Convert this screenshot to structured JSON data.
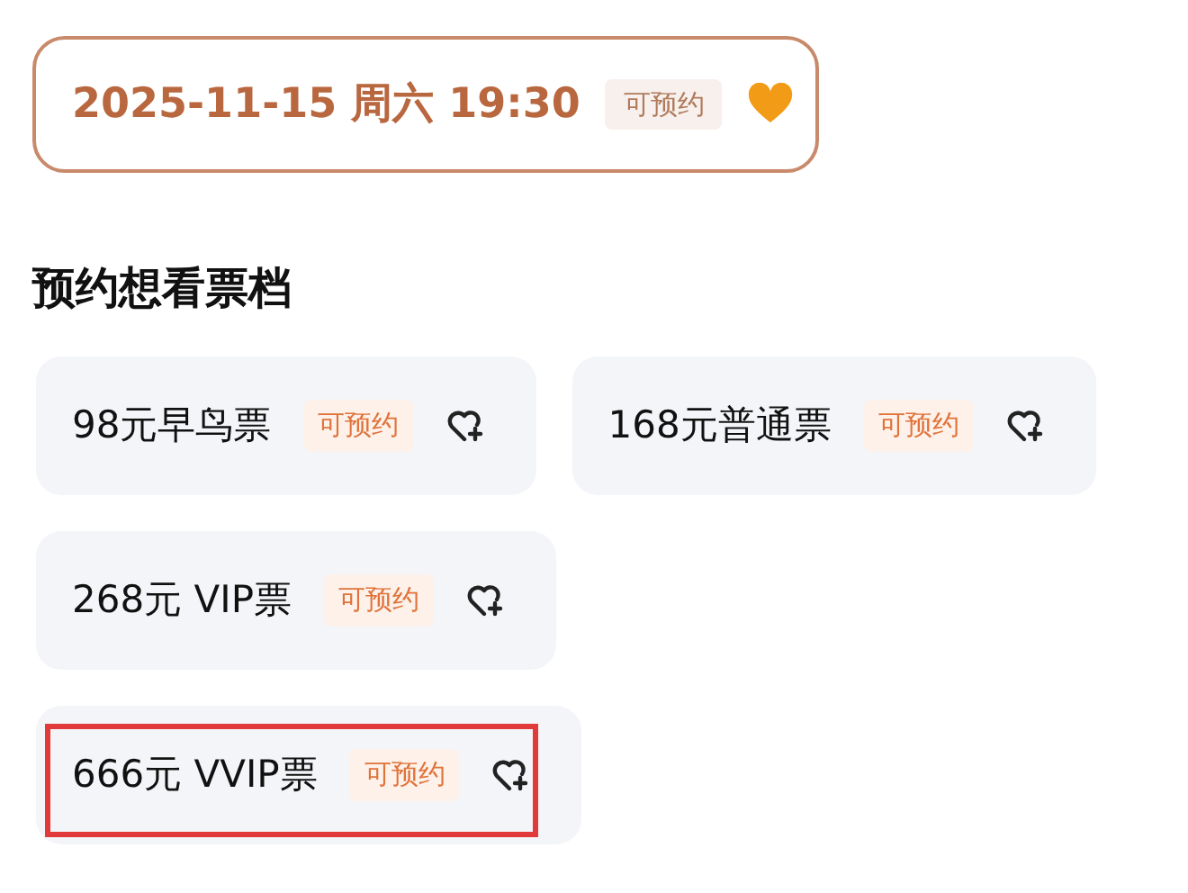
{
  "session": {
    "date": "2025-11-15 周六 19:30",
    "badge": "可预约",
    "selected": true
  },
  "section_title": "预约想看票档",
  "tickets": [
    {
      "name": "98元早鸟票",
      "badge": "可预约",
      "highlighted": false
    },
    {
      "name": "168元普通票",
      "badge": "可预约",
      "highlighted": false
    },
    {
      "name": "268元 VIP票",
      "badge": "可预约",
      "highlighted": false
    },
    {
      "name": "666元 VVIP票",
      "badge": "可预约",
      "highlighted": true
    }
  ]
}
